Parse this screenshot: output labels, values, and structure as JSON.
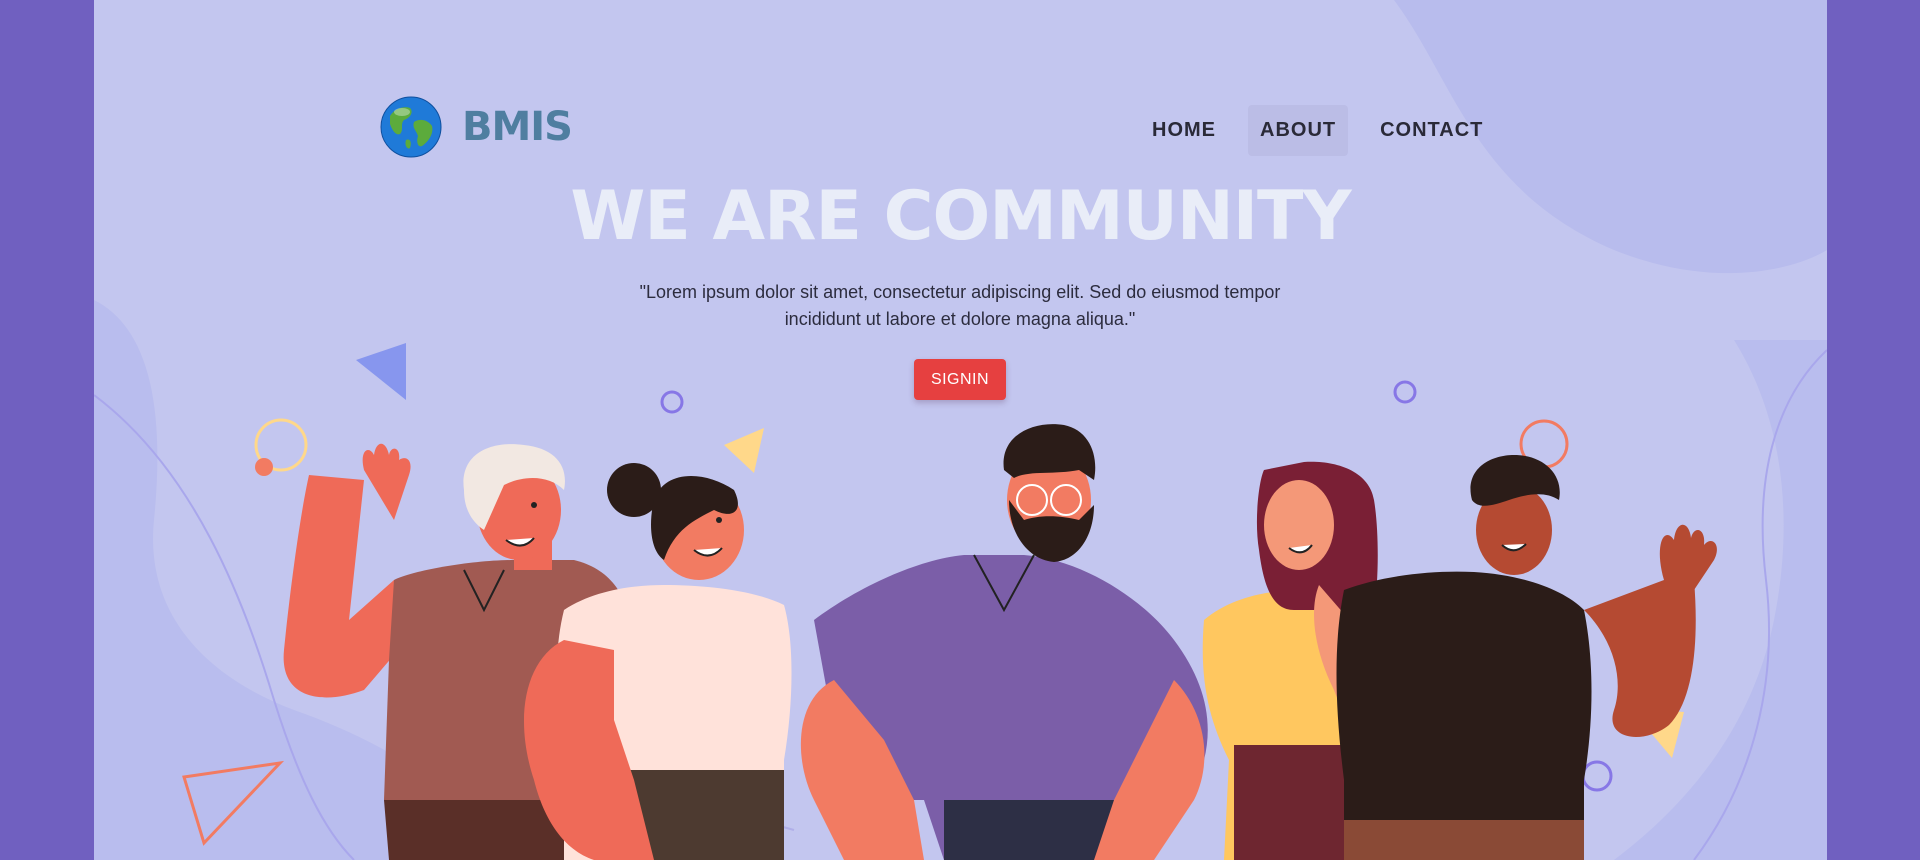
{
  "brand": {
    "name": "BMIS",
    "logo_icon": "globe-icon"
  },
  "nav": {
    "items": [
      {
        "label": "HOME",
        "active": false
      },
      {
        "label": "ABOUT",
        "active": true
      },
      {
        "label": "CONTACT",
        "active": false
      }
    ]
  },
  "hero": {
    "title": "WE ARE COMMUNITY",
    "description": "\"Lorem ipsum dolor sit amet, consectetur adipiscing elit. Sed do eiusmod tempor incididunt ut labore et dolore magna aliqua.\"",
    "button_label": "SIGNIN"
  },
  "colors": {
    "page_border": "#7060c0",
    "background": "#c3c6ef",
    "title": "#e9edf8",
    "button": "#e64040",
    "nav_active": "#bbbde6"
  }
}
